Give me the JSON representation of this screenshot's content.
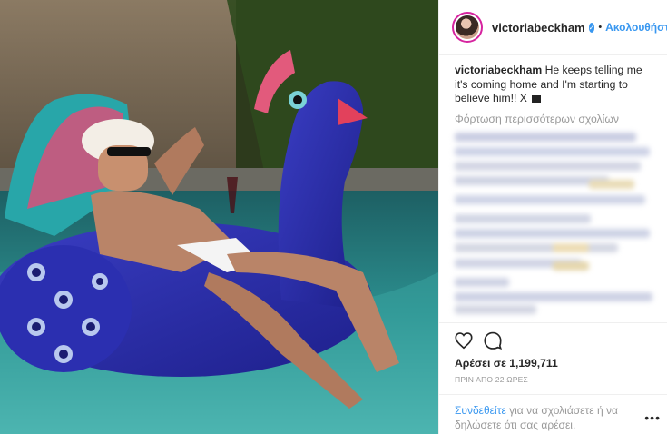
{
  "post": {
    "username": "victoriabeckham",
    "follow_label": "Ακολουθήστε",
    "caption_user": "victoriabeckham",
    "caption_text": "He keeps telling me it's coming home and I'm starting to believe him!! X",
    "load_more_label": "Φόρτωση περισσότερων σχολίων",
    "likes_label": "Αρέσει σε 1,199,711",
    "timestamp": "ΠΡΙΝ ΑΠΟ 22 ΩΡΕΣ",
    "login_link": "Συνδεθείτε",
    "login_text": " για να σχολιάσετε ή να δηλώσετε ότι σας αρέσει.",
    "more_label": "•••"
  },
  "icons": {
    "verified": "verified-badge-icon",
    "like": "heart-icon",
    "comment": "comment-icon",
    "flag": "flag-icon"
  },
  "colors": {
    "accent": "#3897f0",
    "muted": "#999999",
    "text": "#262626"
  }
}
